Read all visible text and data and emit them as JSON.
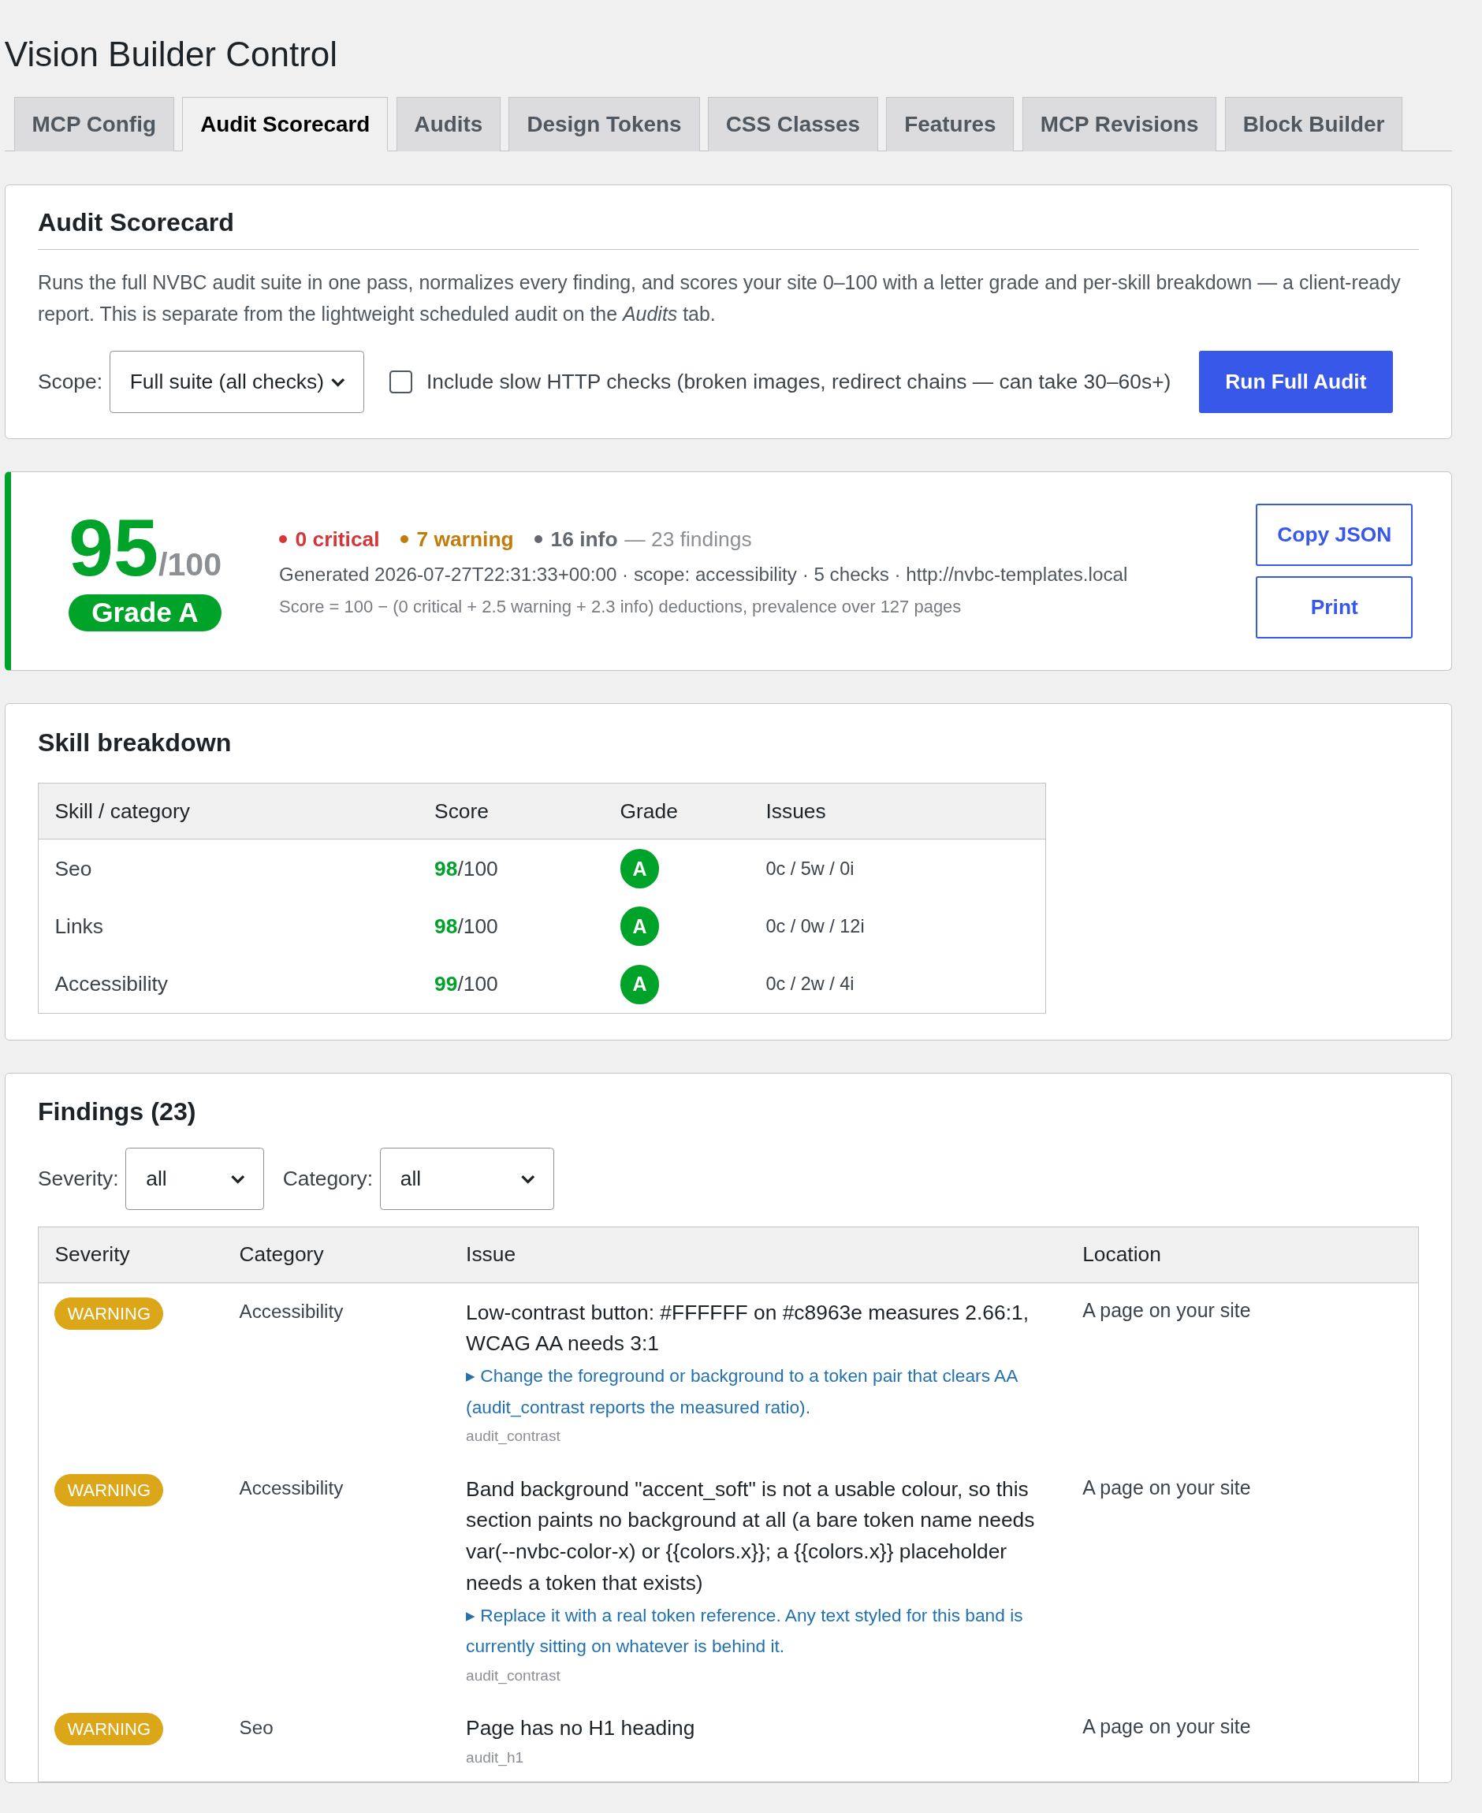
{
  "page_title": "Vision Builder Control",
  "tabs": [
    {
      "label": "MCP Config",
      "selected": false
    },
    {
      "label": "Audit Scorecard",
      "selected": true
    },
    {
      "label": "Audits",
      "selected": false
    },
    {
      "label": "Design Tokens",
      "selected": false
    },
    {
      "label": "CSS Classes",
      "selected": false
    },
    {
      "label": "Features",
      "selected": false
    },
    {
      "label": "MCP Revisions",
      "selected": false
    },
    {
      "label": "Block Builder",
      "selected": false
    }
  ],
  "intro_card": {
    "title": "Audit Scorecard",
    "description": "Runs the full NVBC audit suite in one pass, normalizes every finding, and scores your site 0–100 with a letter grade and per-skill breakdown — a client-ready report. This is separate from the lightweight scheduled audit on the *Audits* tab.",
    "scope_label": "Scope:",
    "scope_value": "Full suite (all checks)",
    "slow_checks": {
      "label": "Include slow HTTP checks (broken images, redirect chains — can take 30–60s+)",
      "checked": false
    },
    "run_button": "Run Full Audit"
  },
  "score_card": {
    "score": "95",
    "out_of": "/100",
    "grade": "Grade A",
    "counts": [
      {
        "kind": "critical",
        "text": "0 critical"
      },
      {
        "kind": "warning",
        "text": "7 warning"
      },
      {
        "kind": "info",
        "text": "16 info"
      }
    ],
    "total": "— 23 findings",
    "generated": "Generated 2026-07-27T22:31:33+00:00 · scope: accessibility · 5 checks · http://nvbc-templates.local",
    "formula": "Score = 100 − (0 critical + 2.5 warning + 2.3 info) deductions, prevalence over 127 pages",
    "buttons": [
      "Copy JSON",
      "Print"
    ]
  },
  "skill_breakdown": {
    "title": "Skill breakdown",
    "columns": [
      "Skill / category",
      "Score",
      "Grade",
      "Issues"
    ],
    "rows": [
      {
        "skill": "Seo",
        "score": "**98**/100",
        "grade": "A",
        "issues": "0c / 5w / 0i"
      },
      {
        "skill": "Links",
        "score": "**98**/100",
        "grade": "A",
        "issues": "0c / 0w / 12i"
      },
      {
        "skill": "Accessibility",
        "score": "**99**/100",
        "grade": "A",
        "issues": "0c / 2w / 4i"
      }
    ]
  },
  "findings": {
    "title": "Findings (23)",
    "filters": [
      {
        "label": "Severity:",
        "value": "all"
      },
      {
        "label": "Category:",
        "value": "all"
      }
    ],
    "columns": [
      "Severity",
      "Category",
      "Issue",
      "Location"
    ],
    "rows": [
      {
        "severity": "WARNING",
        "kind": "warning",
        "category": "Accessibility",
        "issue": "Low-contrast button: #FFFFFF on #c8963e measures 2.66:1, WCAG AA needs 3:1",
        "fix": "▸ Change the foreground or background to a token pair that clears AA (audit_contrast reports the measured ratio).",
        "check": "audit_contrast",
        "location": "A page on your site"
      },
      {
        "severity": "WARNING",
        "kind": "warning",
        "category": "Accessibility",
        "issue": "Band background \"accent_soft\" is not a usable colour, so this section paints no background at all (a bare token name needs var(--nvbc-color-x) or {{colors.x}}; a {{colors.x}} placeholder needs a token that exists)",
        "fix": "▸ Replace it with a real token reference. Any text styled for this band is currently sitting on whatever is behind it.",
        "check": "audit_contrast",
        "location": "A page on your site"
      },
      {
        "severity": "WARNING",
        "kind": "warning",
        "category": "Seo",
        "issue": "Page has no H1 heading",
        "check": "audit_h1",
        "location": "A page on your site"
      }
    ]
  }
}
